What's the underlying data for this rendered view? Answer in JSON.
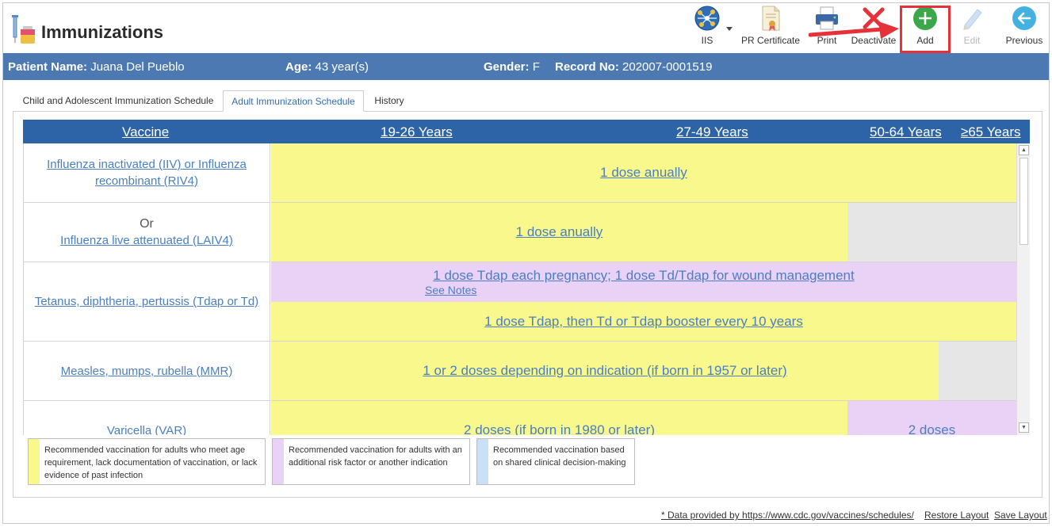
{
  "header": {
    "title": "Immunizations",
    "toolbar": {
      "iis": "IIS",
      "pr_certificate": "PR Certificate",
      "print": "Print",
      "deactivate": "Deactivate",
      "add": "Add",
      "edit": "Edit",
      "previous": "Previous"
    }
  },
  "patient": {
    "name_label": "Patient Name:",
    "name": "Juana Del Pueblo",
    "age_label": "Age:",
    "age": "43 year(s)",
    "gender_label": "Gender:",
    "gender": "F",
    "record_label": "Record No:",
    "record": "202007-0001519"
  },
  "tabs": [
    {
      "label": "Child and Adolescent Immunization Schedule",
      "active": false
    },
    {
      "label": "Adult Immunization Schedule",
      "active": true
    },
    {
      "label": "History",
      "active": false
    }
  ],
  "schedule": {
    "headers": {
      "vaccine": "Vaccine",
      "age1": "19-26 Years",
      "age2": "27-49 Years",
      "age3": "50-64 Years",
      "age4": "≥65 Years"
    },
    "rows": {
      "influenza_inactivated": {
        "vaccine_line1": "Influenza inactivated (IIV) or Influenza",
        "vaccine_line2": "recombinant (RIV4)",
        "recommendation": "1 dose anually"
      },
      "influenza_live": {
        "or_text": "Or",
        "vaccine": "Influenza live attenuated (LAIV4)",
        "recommendation": "1 dose anually"
      },
      "tdap": {
        "vaccine": "Tetanus, diphtheria, pertussis (Tdap or Td)",
        "pregnancy": "1 dose Tdap each pregnancy; 1 dose Td/Tdap for wound management",
        "see_notes": "See Notes",
        "booster": "1 dose Tdap, then Td or Tdap booster every 10 years"
      },
      "mmr": {
        "vaccine": "Measles, mumps, rubella (MMR)",
        "recommendation": "1 or 2 doses depending on indication (if born in 1957 or later)"
      },
      "varicella": {
        "vaccine": "Varicella (VAR)",
        "recommendation": "2 doses (if born in 1980 or later)",
        "recommendation_older": "2 doses"
      }
    }
  },
  "legend": {
    "yellow": {
      "text": "Recommended vaccination for adults who meet age requirement, lack documentation of vaccination, or lack evidence of past infection",
      "color": "#f8f88d"
    },
    "purple": {
      "text": "Recommended vaccination for adults with an additional risk factor or another indication",
      "color": "#ead1f6"
    },
    "blue": {
      "text": "Recommended vaccination based on shared clinical decision-making",
      "color": "#c9e0f6"
    }
  },
  "footer": {
    "source": "* Data provided by https://www.cdc.gov/vaccines/schedules/",
    "restore_layout": "Restore Layout",
    "save_layout": "Save Layout"
  },
  "colors": {
    "patient_bar": "#4d79b3",
    "table_header": "#2d64a7",
    "link": "#4a7fc1",
    "add_highlight": "#e53238"
  }
}
